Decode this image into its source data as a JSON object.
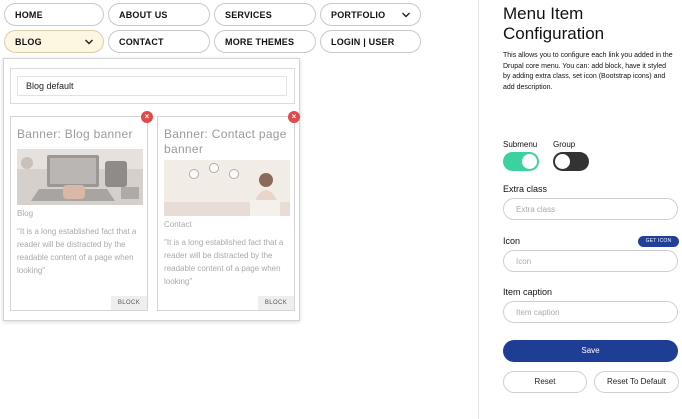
{
  "nav": [
    {
      "label": "HOME",
      "has_dropdown": false
    },
    {
      "label": "ABOUT US",
      "has_dropdown": false
    },
    {
      "label": "SERVICES",
      "has_dropdown": false
    },
    {
      "label": "PORTFOLIO",
      "has_dropdown": true
    },
    {
      "label": "BLOG",
      "has_dropdown": true,
      "active": true
    },
    {
      "label": "CONTACT",
      "has_dropdown": false
    },
    {
      "label": "MORE THEMES",
      "has_dropdown": false
    },
    {
      "label": "LOGIN | USER",
      "has_dropdown": false
    }
  ],
  "dropdown": {
    "heading": "Blog default",
    "cards": [
      {
        "title": "Banner: Blog banner",
        "category": "Blog",
        "quote": "\"It is a long established fact that a reader will be distracted by the readable content of a page when looking\"",
        "button": "BLOCK"
      },
      {
        "title": "Banner: Contact page banner",
        "category": "Contact",
        "quote": "\"It is a long established fact that a reader will be distracted by the readable content of a page when looking\"",
        "button": "BLOCK"
      }
    ]
  },
  "panel": {
    "title": "Menu Item Configuration",
    "description": "This allows you to configure each link you added in the Drupal core menu. You can: add block, have it styled by adding extra class, set icon (Bootstrap icons) and add description.",
    "submenu_label": "Submenu",
    "submenu_on": true,
    "group_label": "Group",
    "group_on": false,
    "extra_class_label": "Extra class",
    "extra_class_placeholder": "Extra class",
    "icon_label": "Icon",
    "icon_placeholder": "Icon",
    "get_icon_label": "GET ICON",
    "caption_label": "Item caption",
    "caption_placeholder": "Item caption",
    "save_label": "Save",
    "reset_label": "Reset",
    "reset_default_label": "Reset To Default"
  },
  "colors": {
    "primary": "#1e3d94",
    "toggle_on": "#3ad39f",
    "toggle_off": "#333333",
    "remove": "#e2494a",
    "active_tab": "#fdf7e2"
  }
}
